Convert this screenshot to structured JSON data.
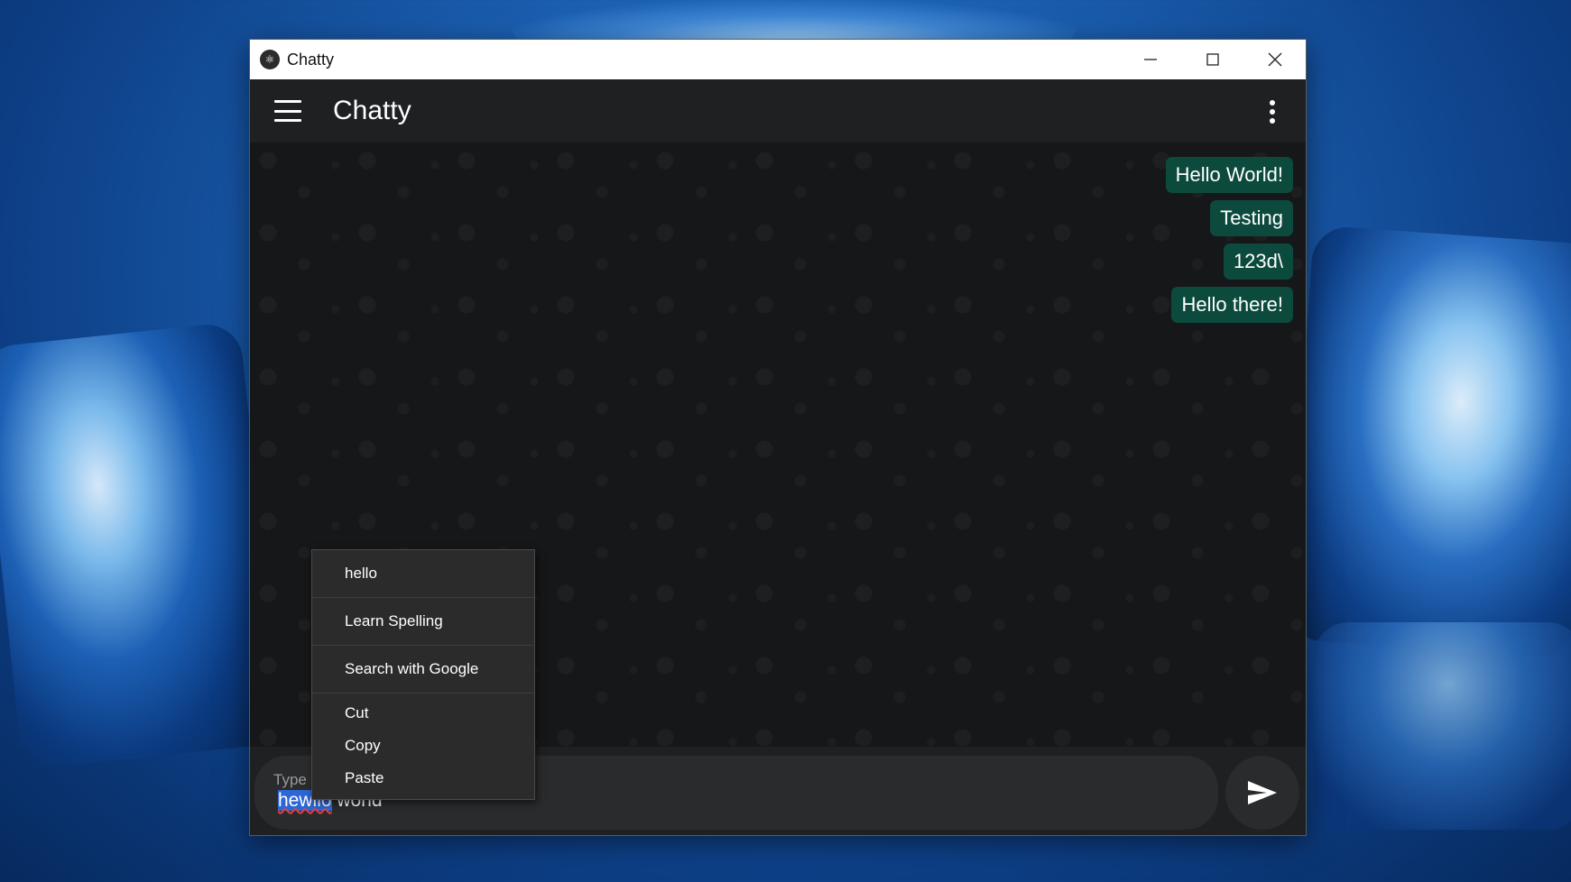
{
  "window": {
    "title": "Chatty",
    "controls": {
      "minimize": "minimize-icon",
      "maximize": "maximize-icon",
      "close": "close-icon"
    }
  },
  "appbar": {
    "title": "Chatty",
    "menu_icon": "hamburger-icon",
    "more_icon": "more-vert-icon"
  },
  "messages": [
    "Hello World!",
    "Testing",
    "123d\\",
    "Hello there!"
  ],
  "composer": {
    "placeholder": "Type",
    "value_selected": "hewllo",
    "value_rest": " world",
    "send_icon": "send-icon"
  },
  "context_menu": {
    "suggestion": "hello",
    "learn_spelling": "Learn Spelling",
    "search": "Search with Google",
    "cut": "Cut",
    "copy": "Copy",
    "paste": "Paste"
  },
  "colors": {
    "bubble": "#0c4a3e",
    "selection": "#2d66d6",
    "app_bg": "#1f2022"
  }
}
